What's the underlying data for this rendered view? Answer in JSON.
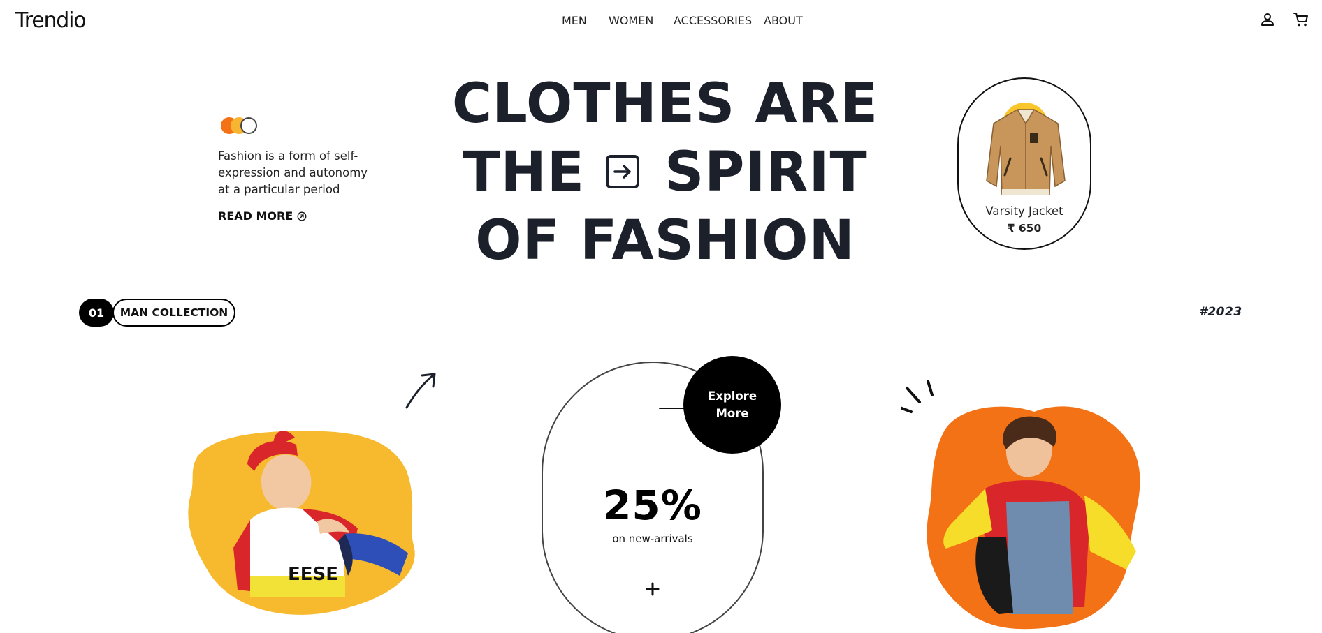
{
  "brand": {
    "logo": "Trendio"
  },
  "nav": {
    "items": [
      "MEN",
      "WOMEN",
      "ACCESSORIES",
      "ABOUT"
    ]
  },
  "header_icons": [
    "user-icon",
    "cart-icon"
  ],
  "hero": {
    "swatches": [
      "#f47216",
      "#f7b531",
      "#ffffff"
    ],
    "description": "Fashion is a form of self-expression and autonomy at a particular period",
    "read_more": "READ MORE",
    "headline": {
      "line1": "CLOTHES ARE",
      "line2_left": "THE",
      "line2_right": "SPIRIT",
      "line3": "OF FASHION"
    }
  },
  "product": {
    "name": "Varsity Jacket",
    "price": "₹ 650"
  },
  "collection": {
    "number": "01",
    "label": "MAN COLLECTION",
    "year": "#2023"
  },
  "offer": {
    "percent": "25%",
    "subtitle": "on new-arrivals",
    "cta": "Explore More"
  },
  "colors": {
    "accent_orange": "#f47216",
    "accent_yellow": "#f9c62b",
    "headline": "#1b202b",
    "black": "#000000"
  }
}
